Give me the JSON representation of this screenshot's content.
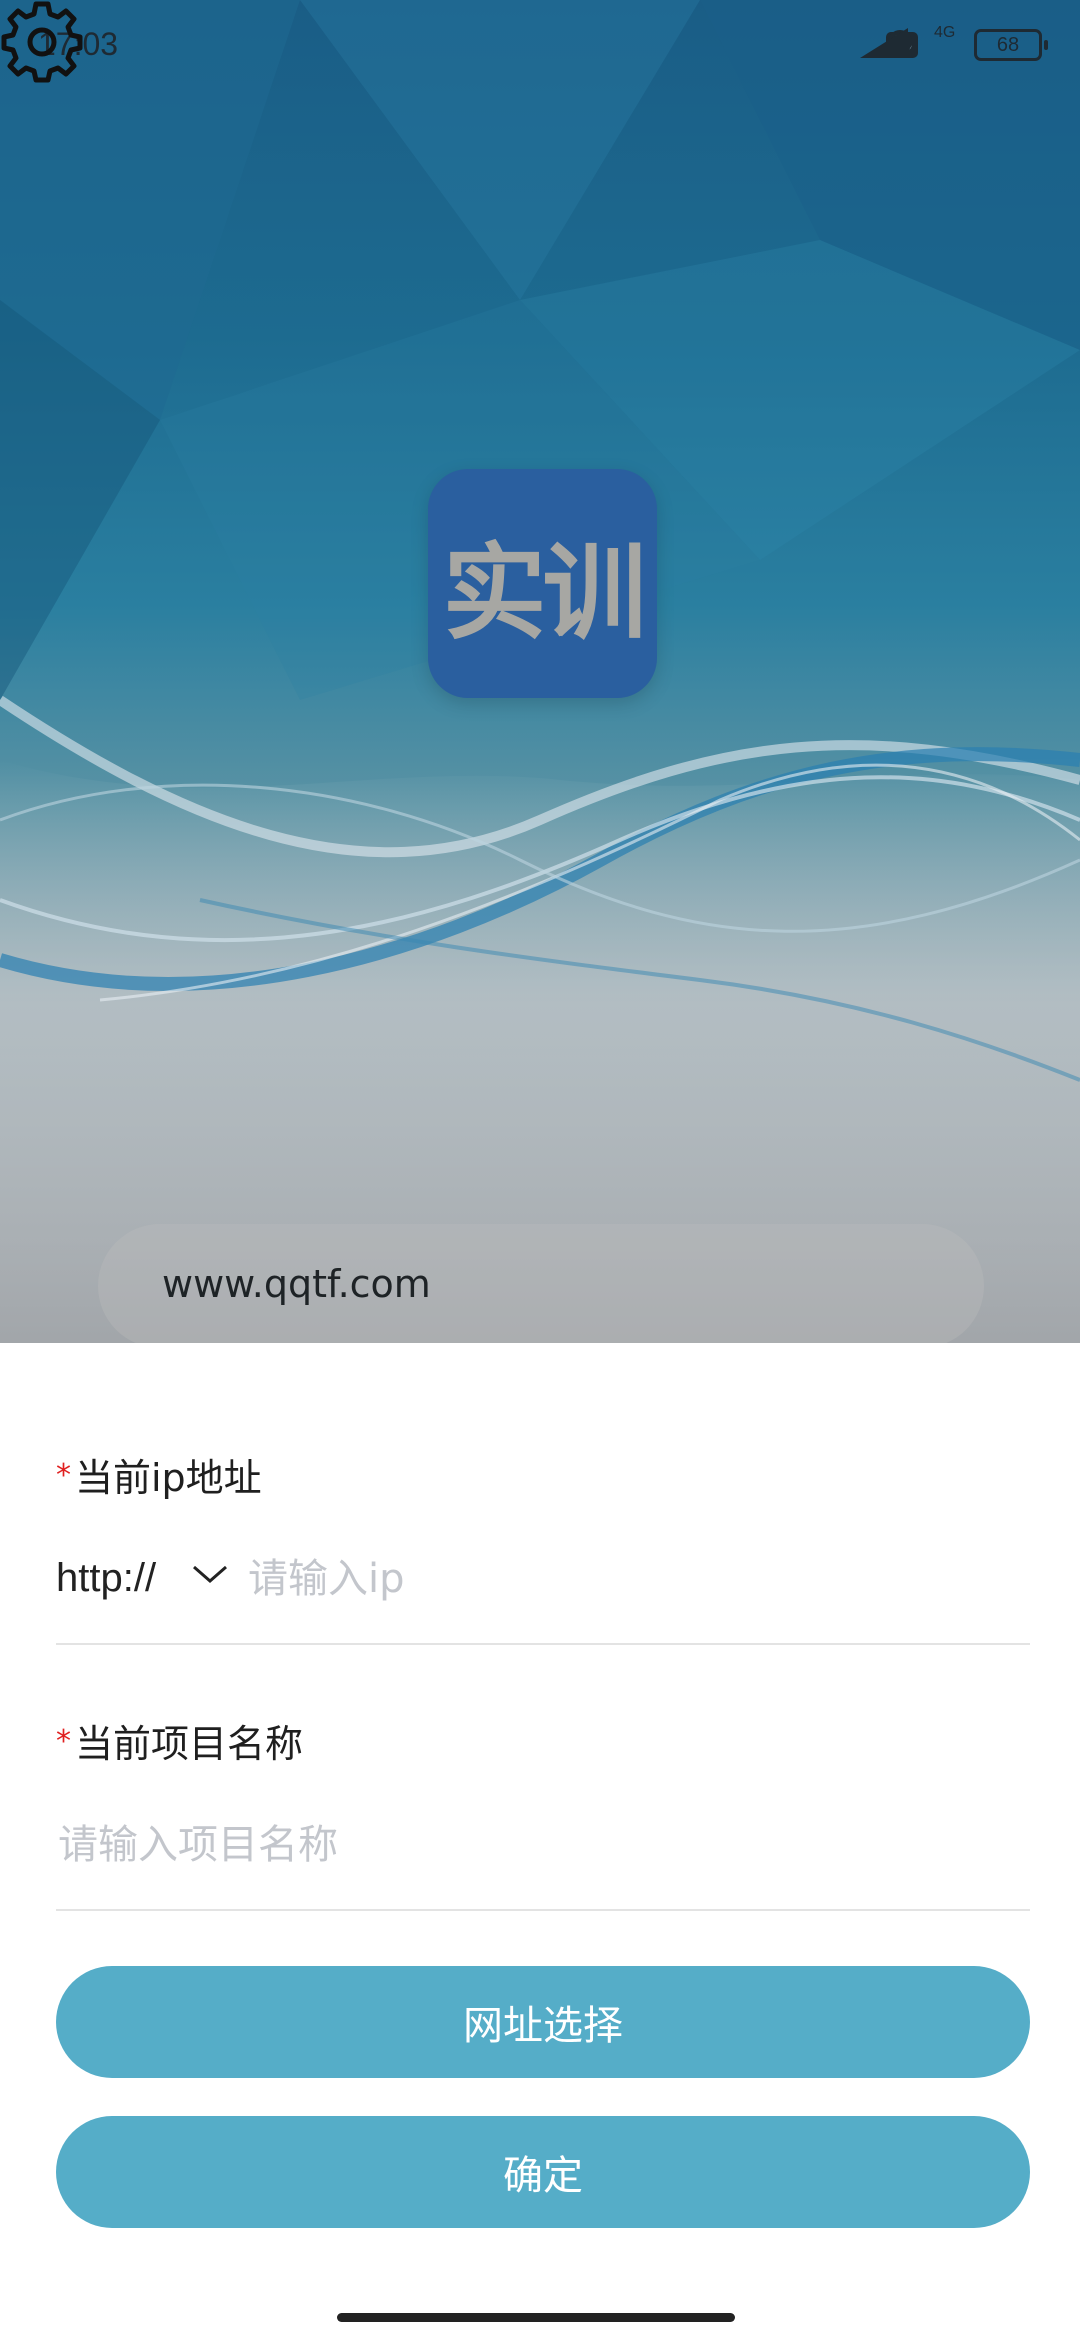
{
  "status_bar": {
    "time": "17:03",
    "hd": "HD",
    "network": "4G",
    "battery": "68"
  },
  "icons": {
    "settings": "gear-icon",
    "dropdown": "chevron-down-icon"
  },
  "logo": {
    "text": "实训"
  },
  "url_pill": {
    "text": "www.qqtf.com"
  },
  "form": {
    "ip_label": "当前ip地址",
    "protocol": "http://",
    "ip_placeholder": "请输入ip",
    "project_label": "当前项目名称",
    "project_placeholder": "请输入项目名称",
    "required_mark": "*"
  },
  "buttons": {
    "select_url": "网址选择",
    "confirm": "确定"
  },
  "colors": {
    "button": "#55adc8",
    "required": "#e02020",
    "logo_bg": "#2a5f9f"
  }
}
